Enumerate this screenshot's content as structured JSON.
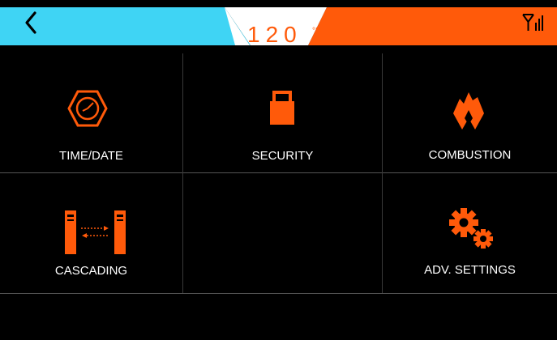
{
  "header": {
    "back_icon": "chevron-left-icon",
    "temperature_value": "120",
    "temperature_unit": "°F",
    "signal_icon": "antenna-signal-icon",
    "colors": {
      "left_accent": "#3fd4f4",
      "right_accent": "#ff5a0a",
      "center": "#ffffff"
    }
  },
  "menu": {
    "items": [
      {
        "label": "TIME/DATE",
        "icon": "clock-hexagon-icon"
      },
      {
        "label": "SECURITY",
        "icon": "lock-icon"
      },
      {
        "label": "COMBUSTION",
        "icon": "flame-icon"
      },
      {
        "label": "CASCADING",
        "icon": "cascade-units-icon"
      },
      {
        "label": "",
        "icon": ""
      },
      {
        "label": "ADV. SETTINGS",
        "icon": "gears-icon"
      }
    ]
  },
  "theme": {
    "icon_color": "#ff5a0a",
    "background": "#000000",
    "text": "#ffffff"
  }
}
